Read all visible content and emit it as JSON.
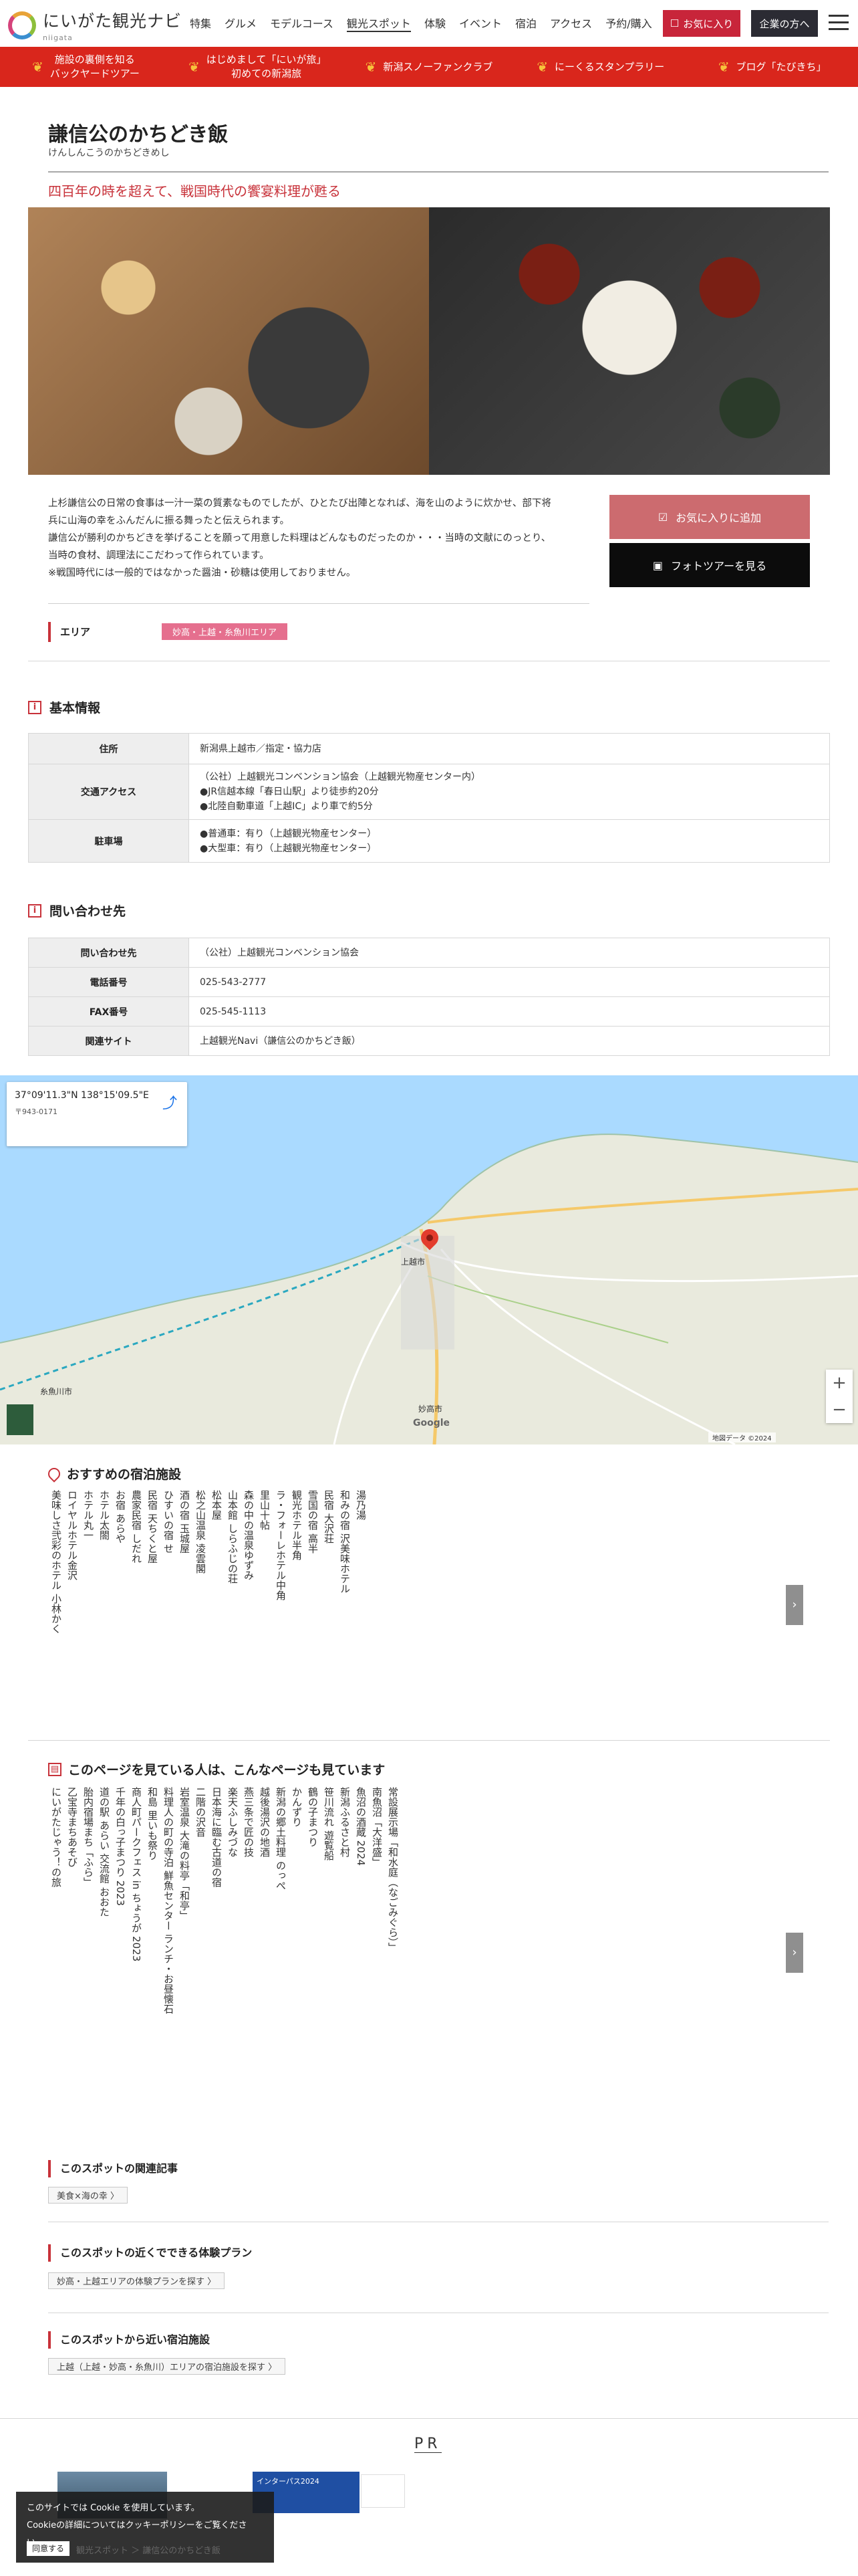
{
  "header": {
    "logo_main": "にいがた観光ナビ",
    "logo_sub": "niigata",
    "nav": [
      "特集",
      "グルメ",
      "モデルコース",
      "観光スポット",
      "体験",
      "イベント",
      "宿泊",
      "アクセス",
      "予約/購入"
    ],
    "fav_label": "お気に入り",
    "corp_label": "企業の方へ"
  },
  "banner": [
    {
      "label": "施設の裏側を知る\nバックヤードツアー"
    },
    {
      "label": "はじめまして「にいが旅」\n初めての新潟旅"
    },
    {
      "label": "新潟スノーファンクラブ"
    },
    {
      "label": "にーくるスタンプラリー"
    },
    {
      "label": "ブログ「たびきち」"
    }
  ],
  "page": {
    "title": "謙信公のかちどき飯",
    "reading": "けんしんこうのかちどきめし",
    "catch": "四百年の時を超えて、戦国時代の饗宴料理が甦る",
    "description": [
      "上杉謙信公の日常の食事は一汁一菜の質素なものでしたが、ひとたび出陣となれば、海を山のように炊かせ、部下将",
      "兵に山海の幸をふんだんに振る舞ったと伝えられます。",
      "謙信公が勝利のかちどきを挙げることを願って用意した料理はどんなものだったのか・・・当時の文献にのっとり、",
      "当時の食材、調理法にこだわって作られています。",
      "※戦国時代には一般的ではなかった醤油・砂糖は使用しておりません。"
    ],
    "add_fav": "お気に入りに追加",
    "photo_tour": "フォトツアーを見る",
    "area_label": "エリア",
    "area_tag": "妙高・上越・糸魚川エリア"
  },
  "basic": {
    "heading": "基本情報",
    "rows": [
      {
        "label": "住所",
        "lines": [
          "新潟県上越市／指定・協力店"
        ]
      },
      {
        "label": "交通アクセス",
        "lines": [
          "（公社）上越観光コンベンション協会（上越観光物産センター内）",
          "●JR信越本線「春日山駅」より徒歩約20分",
          "●北陸自動車道「上越IC」より車で約5分"
        ]
      },
      {
        "label": "駐車場",
        "lines": [
          "●普通車：有り（上越観光物産センター）",
          "●大型車：有り（上越観光物産センター）"
        ]
      }
    ]
  },
  "contact": {
    "heading": "問い合わせ先",
    "rows": [
      {
        "label": "問い合わせ先",
        "lines": [
          "（公社）上越観光コンベンション協会"
        ]
      },
      {
        "label": "電話番号",
        "lines": [
          "025-543-2777"
        ]
      },
      {
        "label": "FAX番号",
        "lines": [
          "025-545-1113"
        ]
      },
      {
        "label": "関連サイト",
        "lines": [
          "上越観光Navi（謙信公のかちどき飯）"
        ]
      }
    ]
  },
  "map": {
    "coord": "37°09'11.3\"N 138°15'09.5\"E",
    "addr": "〒943-0171",
    "city_joetsu": "上越市",
    "city_myoko": "妙高市",
    "city_itoigawa": "糸魚川市",
    "google": "Google",
    "footer": "地図データ ©2024"
  },
  "lodging": {
    "heading": "おすすめの宿泊施設",
    "items": [
      "美味しさ弐彩のホテル 小林かく",
      "ロイヤルホテル金沢",
      "ホテル丸一",
      "ホテル太閤",
      "お宿 あらや",
      "農家民宿 しだれ",
      "民宿 天ちくと屋",
      "ひすいの宿 せ",
      "酒の宿 玉城屋",
      "松之山温泉 凌雲閣",
      "松本屋",
      "山本館 しらふじの荘",
      "森の中の温泉ゆずみ",
      "里山十帖",
      "ラ・フォーレホテル中角",
      "観光ホテル半角",
      "雪国の宿 高半",
      "民宿 大沢荘",
      "和みの宿 沢美味ホテル",
      "湯乃湯"
    ]
  },
  "viewed": {
    "heading": "このページを見ている人は、こんなページも見ています",
    "items": [
      "にいがたじゃう！の旅",
      "乙宝寺まちあそび",
      "胎内宿場まち「ふら」",
      "道の駅 あらい 交流館 おおた",
      "千年の白っ子まつり 2023",
      "商人町パークフェス in ちょうが 2023",
      "和島 里いも祭り",
      "料理人の町の寺泊 鮮魚センター ランチ・お昼懐石",
      "岩室温泉 大滝の料亭「和亭」",
      "二階の沢音",
      "日本海に臨む古道の宿",
      "楽天ふしみづな",
      "燕三条で匠の技",
      "越後湯沢の地酒",
      "新潟の郷土料理 のっぺ",
      "かんずり",
      "鶴の子まつり",
      "笹川流れ 遊覧船",
      "新潟ふるさと村",
      "魚沼の酒蔵 2024",
      "南魚沼「大洋盛」",
      "常設展示場「和水庭（なごみぐら）」"
    ]
  },
  "related": [
    {
      "heading": "このスポットの関連記事",
      "link": "美食×海の幸 〉"
    },
    {
      "heading": "このスポットの近くでできる体験プラン",
      "link": "妙高・上越エリアの体験プランを探す 〉"
    },
    {
      "heading": "このスポットから近い宿泊施設",
      "link": "上越（上越・妙高・糸魚川）エリアの宿泊施設を探す 〉"
    }
  ],
  "pr": {
    "title": "PR",
    "banner2": "インターパス2024"
  },
  "cookie": {
    "line1": "このサイトでは Cookie を使用しています。",
    "line2": "Cookieの詳細についてはクッキーポリシーをご覧ください。",
    "agree": "同意する"
  },
  "breadcrumb": "観光スポット ＞ 謙信公のかちどき飯"
}
